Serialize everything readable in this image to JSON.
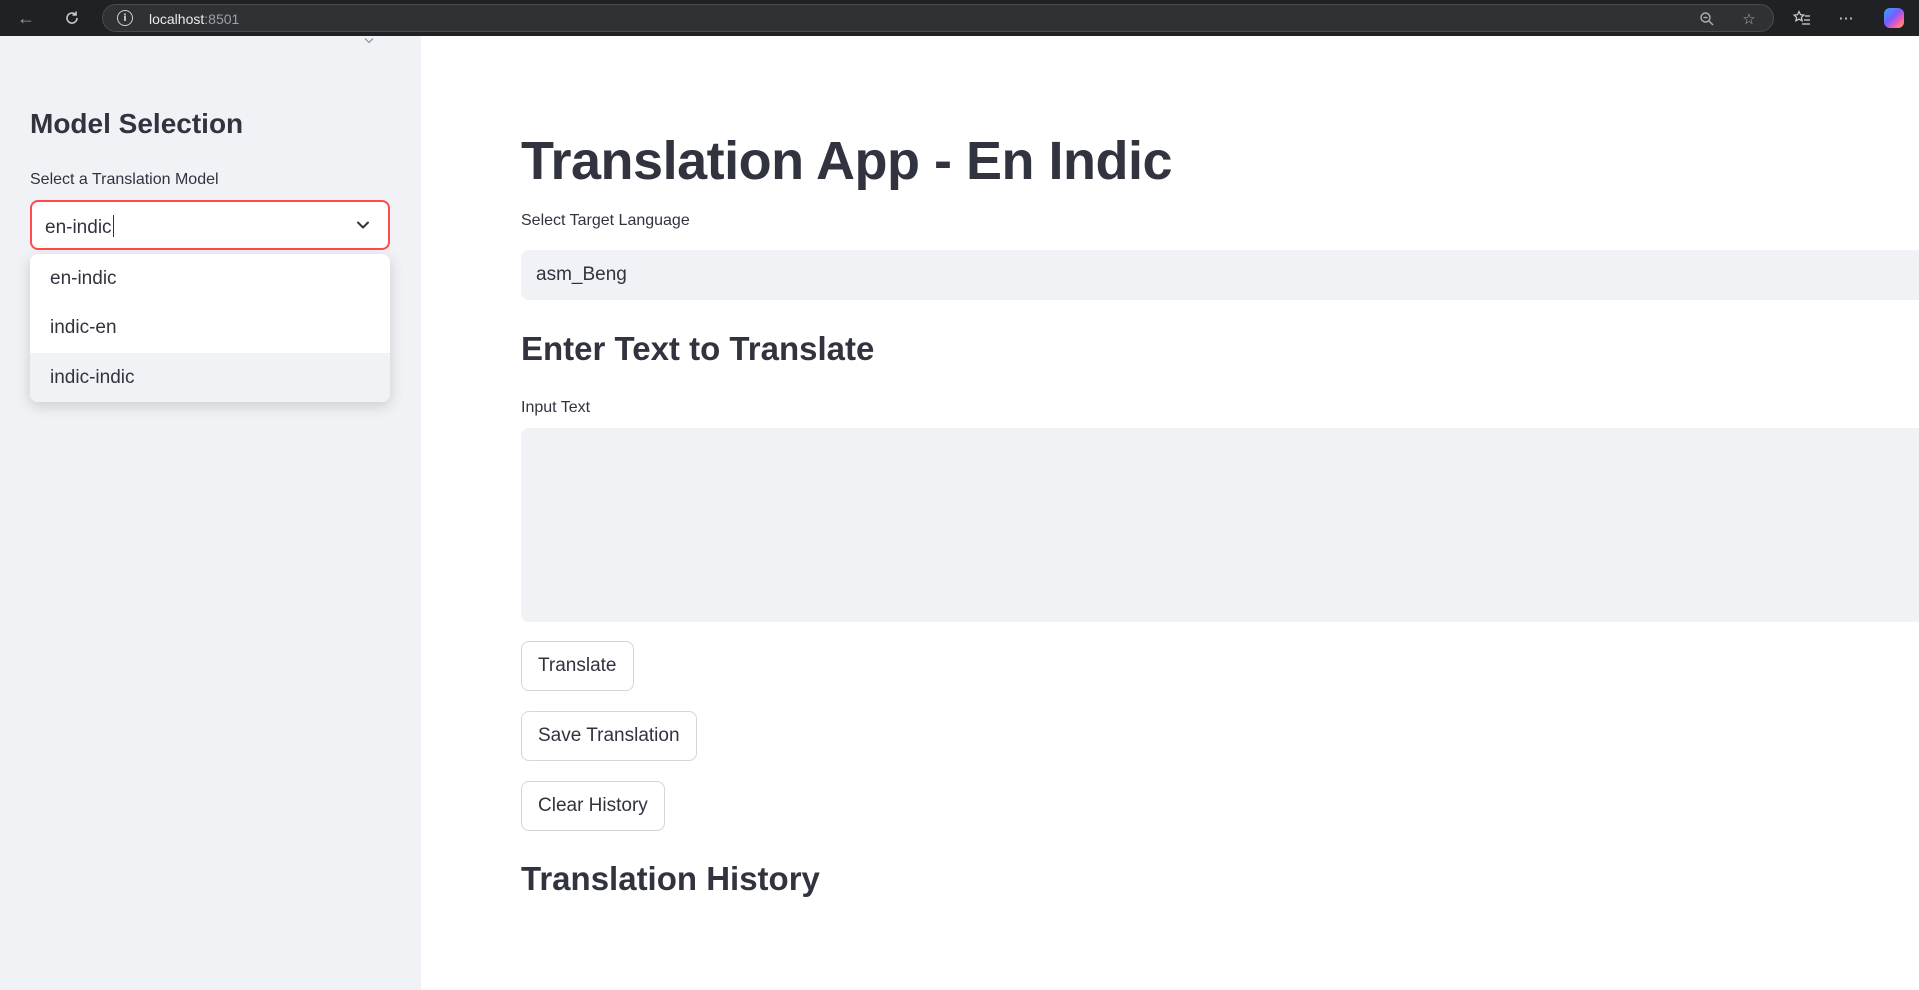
{
  "browser": {
    "url_host": "localhost",
    "url_port": ":8501",
    "icons": [
      "back-arrow-icon",
      "refresh-icon",
      "info-icon",
      "zoom-out-icon",
      "star-icon",
      "favorites-icon",
      "more-icon",
      "copilot-icon"
    ]
  },
  "sidebar": {
    "title": "Model Selection",
    "model_select": {
      "label": "Select a Translation Model",
      "value": "en-indic",
      "options": [
        "en-indic",
        "indic-en",
        "indic-indic"
      ],
      "hovered_option": "indic-indic"
    }
  },
  "main": {
    "title": "Translation App - En Indic",
    "target_language": {
      "label": "Select Target Language",
      "value": "asm_Beng"
    },
    "input_section": {
      "heading": "Enter Text to Translate",
      "input_label": "Input Text",
      "input_value": ""
    },
    "buttons": {
      "translate": "Translate",
      "save": "Save Translation",
      "clear": "Clear History"
    },
    "history_heading": "Translation History"
  },
  "colors": {
    "accent": "#ff4b4b",
    "sidebar_bg": "#f0f2f6",
    "text": "#31333f",
    "browser_bg": "#202124"
  }
}
